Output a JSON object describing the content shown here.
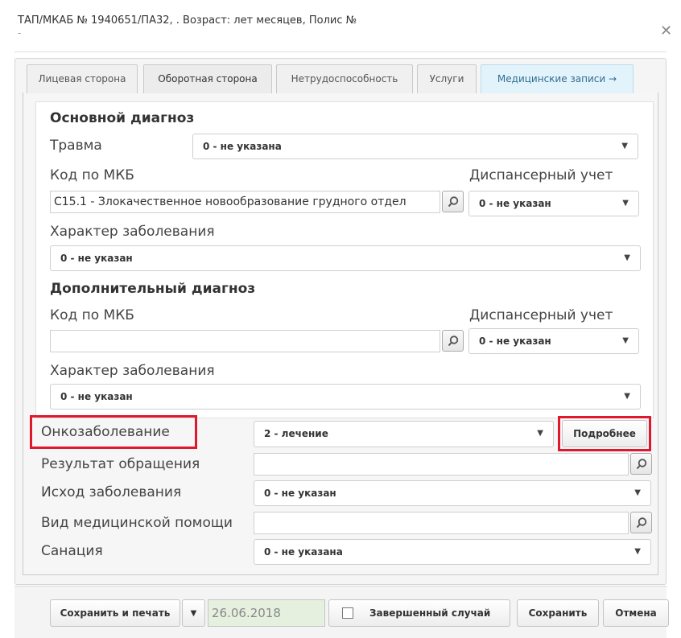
{
  "header": {
    "title": "ТАП/МКАБ № 1940651/ПА32,                                                  . Возраст:   лет   месяцев, Полис №",
    "subtitle": "-"
  },
  "tabs": [
    {
      "label": "Лицевая сторона"
    },
    {
      "label": "Оборотная сторона"
    },
    {
      "label": "Нетрудоспособность"
    },
    {
      "label": "Услуги"
    },
    {
      "label": "Медицинские записи →"
    }
  ],
  "main_diagnosis": {
    "section_title": "Основной диагноз",
    "trauma_label": "Травма",
    "trauma_value": "0 - не указана",
    "mkb_label": "Код по МКБ",
    "mkb_value": "С15.1 - Злокачественное новообразование грудного отдел",
    "dispensary_label": "Диспансерный учет",
    "dispensary_value": "0 - не указан",
    "character_label": "Характер заболевания",
    "character_value": "0 - не указан"
  },
  "extra_diagnosis": {
    "section_title": "Дополнительный диагноз",
    "mkb_label": "Код по МКБ",
    "mkb_value": "",
    "dispensary_label": "Диспансерный учет",
    "dispensary_value": "0 - не указан",
    "character_label": "Характер заболевания",
    "character_value": "0 - не указан"
  },
  "onco": {
    "label": "Онкозаболевание",
    "value": "2 - лечение",
    "details_button": "Подробнее"
  },
  "result": {
    "label": "Результат обращения",
    "value": ""
  },
  "outcome": {
    "label": "Исход заболевания",
    "value": "0 - не указан"
  },
  "care_type": {
    "label": "Вид медицинской помощи",
    "value": ""
  },
  "sanation": {
    "label": "Санация",
    "value": "0 - не указана"
  },
  "footer": {
    "save_print": "Сохранить и печать",
    "date": "26.06.2018",
    "completed_case": "Завершенный случай",
    "save": "Сохранить",
    "cancel": "Отмена"
  },
  "colors": {
    "highlight": "#e0182e",
    "tab_medical": "#e3f3fb",
    "date_bg": "#e6f0df"
  }
}
